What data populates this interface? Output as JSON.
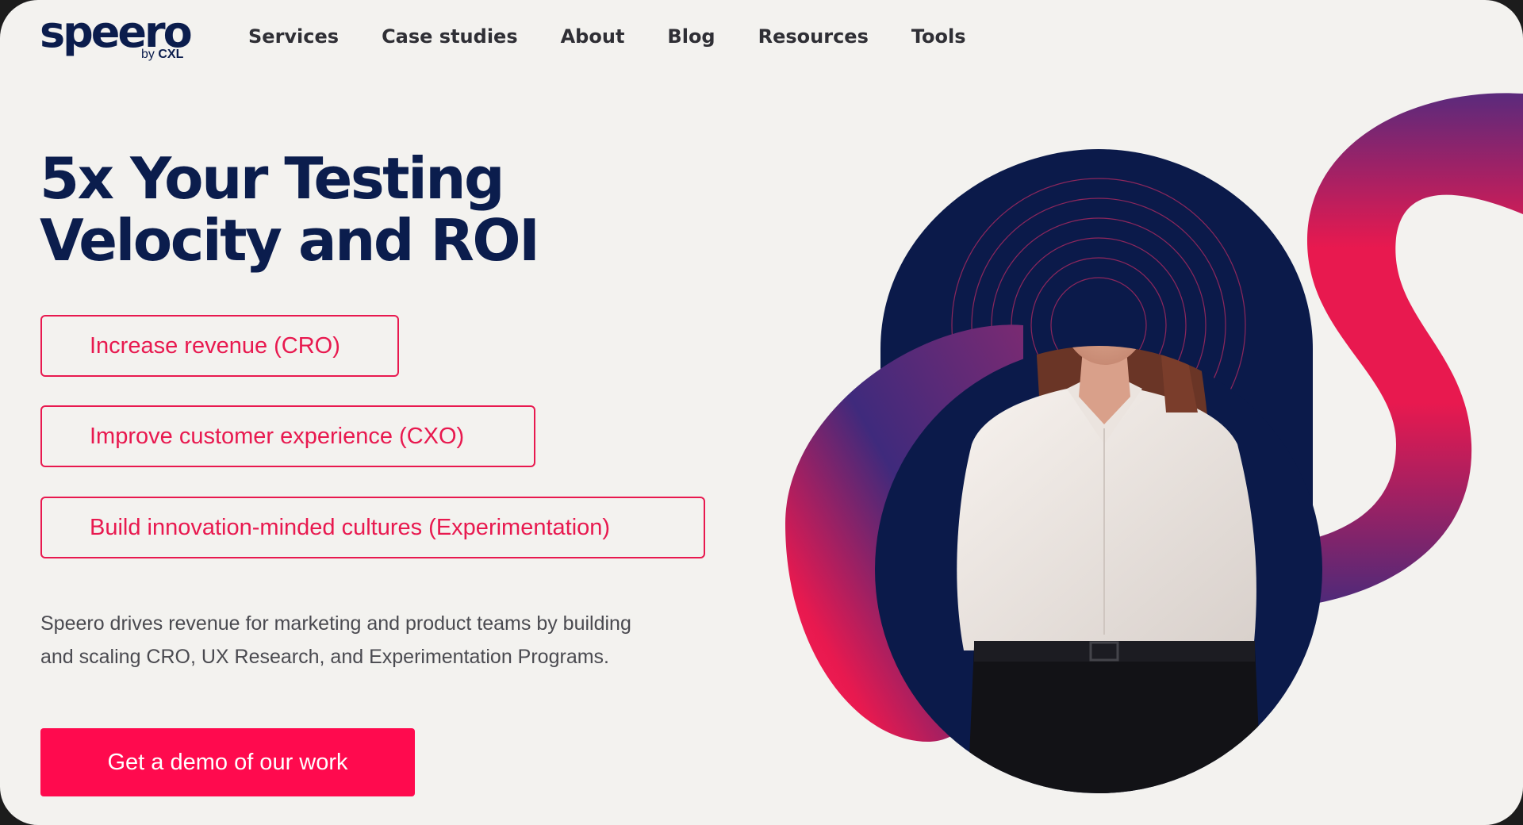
{
  "brand": {
    "logo_text": "speero",
    "by_prefix": "by",
    "by_brand": "CXL"
  },
  "nav": [
    "Services",
    "Case studies",
    "About",
    "Blog",
    "Resources",
    "Tools"
  ],
  "hero": {
    "headline_line1": "5x Your Testing",
    "headline_line2": "Velocity and ROI",
    "options": [
      "Increase revenue (CRO)",
      "Improve customer experience (CXO)",
      "Build innovation-minded cultures (Experimentation)"
    ],
    "description_line1": "Speero drives revenue for marketing and product teams by building",
    "description_line2": "and scaling CRO, UX Research, and Experimentation Programs.",
    "cta": "Get a demo of our work"
  },
  "colors": {
    "navy": "#0b1d4d",
    "accent": "#e8194f",
    "cta": "#ff0a4e",
    "background": "#f3f2ef"
  },
  "image": {
    "subject": "woman-in-white-shirt-portrait"
  }
}
